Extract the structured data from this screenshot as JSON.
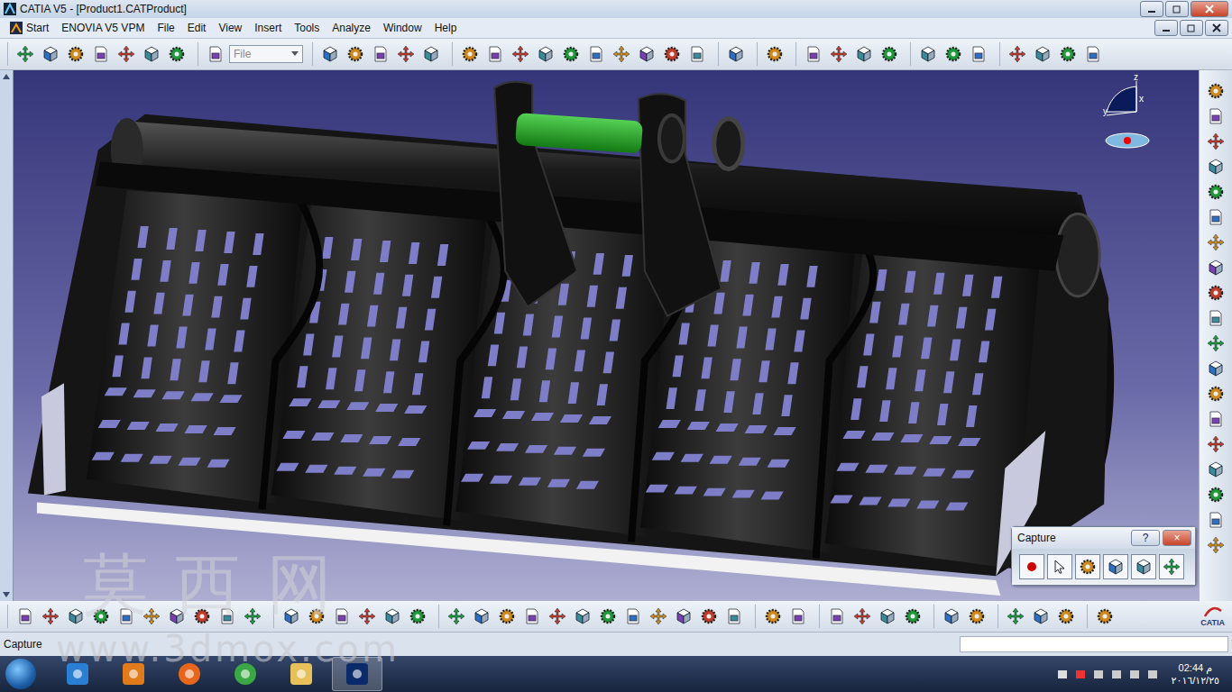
{
  "window": {
    "title": "CATIA V5 - [Product1.CATProduct]"
  },
  "menu": [
    {
      "label": "Start"
    },
    {
      "label": "ENOVIA V5 VPM"
    },
    {
      "label": "File"
    },
    {
      "label": "Edit"
    },
    {
      "label": "View"
    },
    {
      "label": "Insert"
    },
    {
      "label": "Tools"
    },
    {
      "label": "Analyze"
    },
    {
      "label": "Window"
    },
    {
      "label": "Help"
    }
  ],
  "toolbar": {
    "combo": "File"
  },
  "compass": {
    "axes": [
      "z",
      "x",
      "y"
    ]
  },
  "capture_dialog": {
    "title": "Capture",
    "help": "?",
    "close": "×"
  },
  "status_bar": {
    "text": "Capture"
  },
  "brand": "CATIA",
  "watermark": {
    "title": "莫西网",
    "url": "www.3dmox.com"
  },
  "taskbar": {
    "time": "02:44 م",
    "date": "٢٠١٦/١٢/٢٥"
  }
}
